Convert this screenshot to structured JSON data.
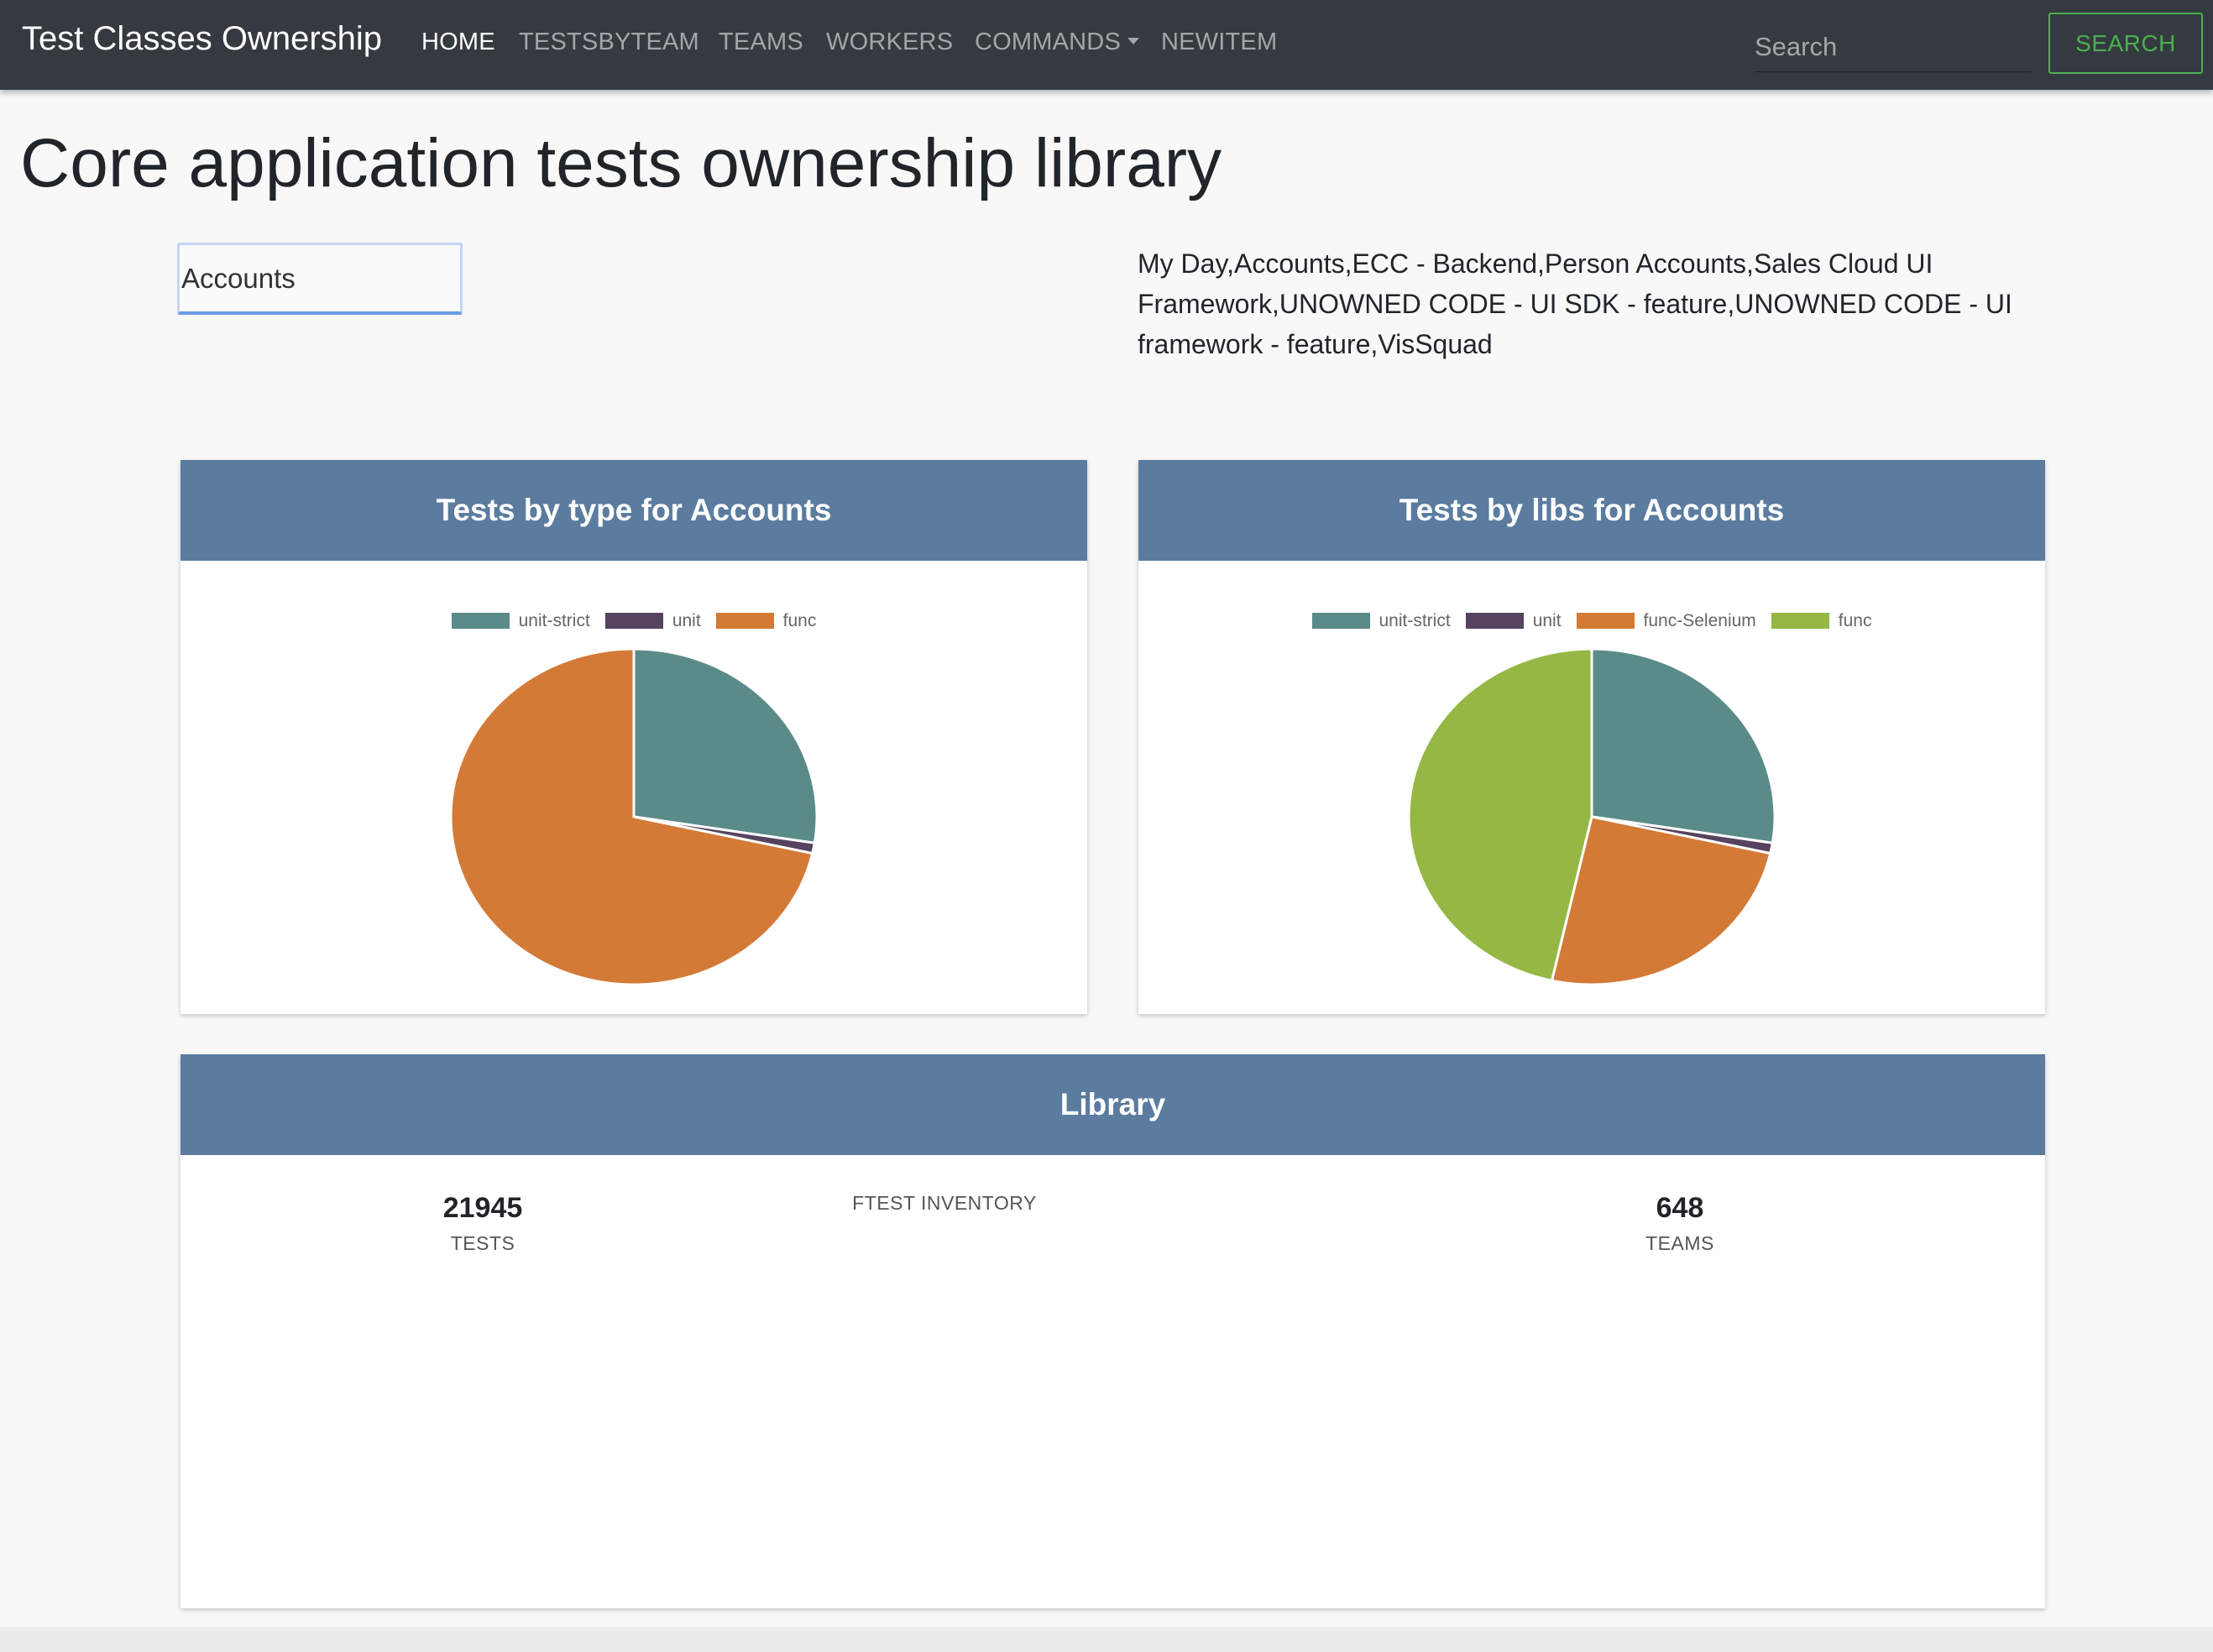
{
  "navbar": {
    "brand": "Test Classes Ownership",
    "items": [
      {
        "label": "HOME",
        "active": true
      },
      {
        "label": "TESTSBYTEAM"
      },
      {
        "label": "TEAMS"
      },
      {
        "label": "WORKERS"
      },
      {
        "label": "COMMANDS",
        "dropdown": true
      },
      {
        "label": "NEWITEM"
      }
    ],
    "search_placeholder": "Search",
    "search_button": "SEARCH"
  },
  "page": {
    "title": "Core application tests ownership library",
    "team_input_value": "Accounts",
    "team_list": "My Day,Accounts,ECC - Backend,Person Accounts,Sales Cloud UI Framework,UNOWNED CODE - UI SDK - feature,UNOWNED CODE - UI framework - feature,VisSquad"
  },
  "colors": {
    "unit_strict": "#5b8b89",
    "unit": "#55435f",
    "func": "#d47a37",
    "func_selenium": "#d47a37",
    "func_green": "#94b843",
    "card_header": "#5b7c9f"
  },
  "chart_data": [
    {
      "type": "pie",
      "title": "Tests by type for Accounts",
      "labels": [
        "unit-strict",
        "unit",
        "func"
      ],
      "values": [
        27.5,
        1.0,
        71.5
      ],
      "colors": [
        "#5b8b89",
        "#55435f",
        "#d47a37"
      ]
    },
    {
      "type": "pie",
      "title": "Tests by libs for Accounts",
      "labels": [
        "unit-strict",
        "unit",
        "func-Selenium",
        "func"
      ],
      "values": [
        27.5,
        1.0,
        25.0,
        46.5
      ],
      "colors": [
        "#5b8b89",
        "#55435f",
        "#d47a37",
        "#94b843"
      ]
    }
  ],
  "library": {
    "title": "Library",
    "tests_count": "21945",
    "tests_label": "TESTS",
    "inventory_label": "FTEST INVENTORY",
    "teams_count": "648",
    "teams_label": "TEAMS"
  }
}
